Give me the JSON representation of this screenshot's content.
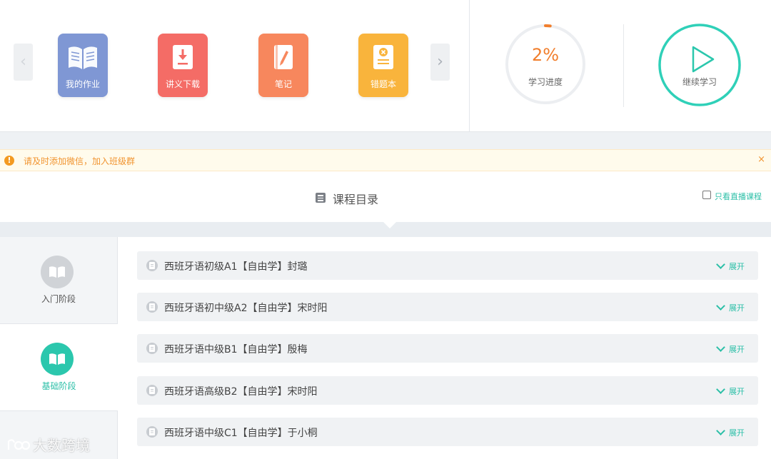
{
  "toolbar": {
    "prev_arrow": "‹",
    "next_arrow": "›",
    "tools": [
      {
        "label": "我的作业",
        "icon": "open-book-icon",
        "color": "#7f97d4"
      },
      {
        "label": "讲义下载",
        "icon": "download-icon",
        "color": "#f46c66"
      },
      {
        "label": "笔记",
        "icon": "note-icon",
        "color": "#f7875d"
      },
      {
        "label": "错题本",
        "icon": "error-book-icon",
        "color": "#f9b43c"
      }
    ]
  },
  "progress": {
    "percent_text": "2%",
    "value": 0.02,
    "label": "学习进度"
  },
  "continue": {
    "label": "继续学习"
  },
  "notice": {
    "icon_text": "!",
    "text": "请及时添加微信，加入班级群",
    "close": "×"
  },
  "catalog": {
    "title": "课程目录",
    "live_only_label": "只看直播课程",
    "live_only_checked": false
  },
  "stages": [
    {
      "label": "入门阶段",
      "active": false
    },
    {
      "label": "基础阶段",
      "active": true
    }
  ],
  "courses": [
    {
      "name": "西班牙语初级A1【自由学】封璐",
      "action": "展开"
    },
    {
      "name": "西班牙语初中级A2【自由学】宋时阳",
      "action": "展开"
    },
    {
      "name": "西班牙语中级B1【自由学】殷梅",
      "action": "展开"
    },
    {
      "name": "西班牙语高级B2【自由学】宋时阳",
      "action": "展开"
    },
    {
      "name": "西班牙语中级C1【自由学】于小桐",
      "action": "展开"
    }
  ],
  "watermark": {
    "text": "大数跨境"
  },
  "colors": {
    "accent": "#2bbfa7",
    "progress": "#f17e2c",
    "notice_text": "#f19430"
  }
}
